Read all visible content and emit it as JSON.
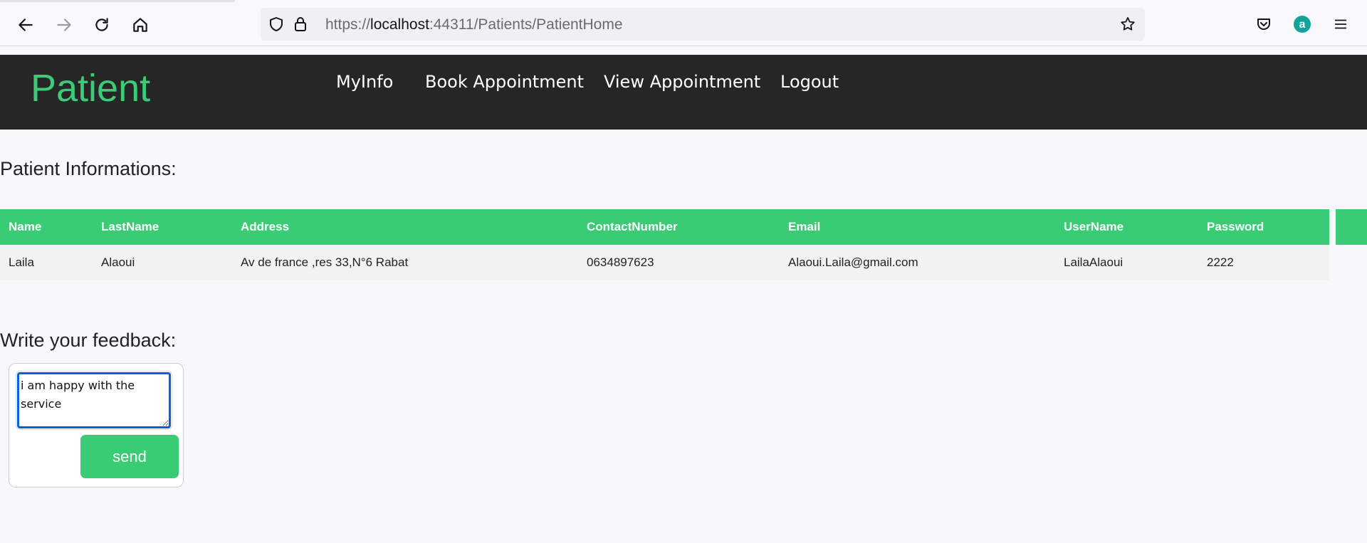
{
  "browser": {
    "url_scheme": "https://",
    "url_host": "localhost",
    "url_rest": ":44311/Patients/PatientHome",
    "icons": [
      "back-icon",
      "forward-icon",
      "reload-icon",
      "home-icon",
      "shield-icon",
      "lock-icon",
      "star-icon",
      "pocket-icon",
      "account-icon",
      "menu-icon"
    ]
  },
  "header": {
    "brand": "Patient",
    "nav": [
      "MyInfo",
      "Book Appointment",
      "View Appointment",
      "Logout"
    ]
  },
  "info": {
    "title": "Patient Informations:",
    "columns": [
      "Name",
      "LastName",
      "Address",
      "ContactNumber",
      "Email",
      "UserName",
      "Password"
    ],
    "row": [
      "Laila",
      "Alaoui",
      "Av de france ,res 33,N°6 Rabat",
      "0634897623",
      "Alaoui.Laila@gmail.com",
      "LailaAlaoui",
      "2222"
    ]
  },
  "feedback": {
    "title": "Write your feedback:",
    "value": "i am happy with the service",
    "send_label": "send"
  },
  "colors": {
    "accent": "#39cc75",
    "header_bg": "#262626",
    "focus": "#0a60d6"
  }
}
